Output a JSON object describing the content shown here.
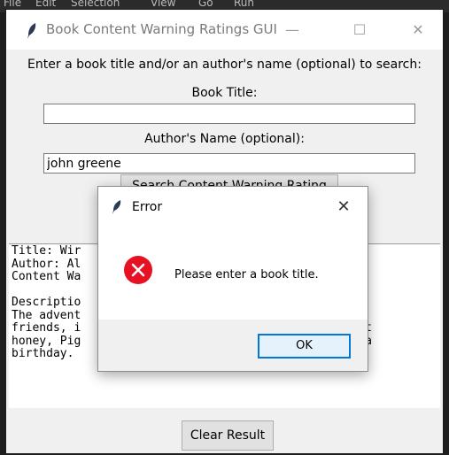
{
  "background": {
    "menu": [
      "File",
      "Edit",
      "Selection",
      "View",
      "Go",
      "Run"
    ]
  },
  "window": {
    "title": "Book Content Warning Ratings GUI",
    "controls": {
      "minimize": "—",
      "maximize": "☐",
      "close": "✕"
    },
    "prompt": "Enter a book title and/or an author's name (optional) to search:",
    "book_title_label": "Book Title:",
    "book_title_value": "",
    "author_label": "Author's Name (optional):",
    "author_value": "john greene",
    "search_button": "Search Content Warning Rating",
    "result_text": "Title: Wir                                  ion\nAuthor: Al\nContent Wa\n\nDescriptio\nThe advent                                  is\nfriends, i                                  n to get\nhoney, Pig                                  re has a\nbirthday.",
    "clear_button": "Clear Result"
  },
  "dialog": {
    "title": "Error",
    "close": "✕",
    "message": "Please enter a book title.",
    "ok_button": "OK",
    "colors": {
      "error_icon": "#e81123",
      "ok_border": "#0078d7"
    }
  }
}
